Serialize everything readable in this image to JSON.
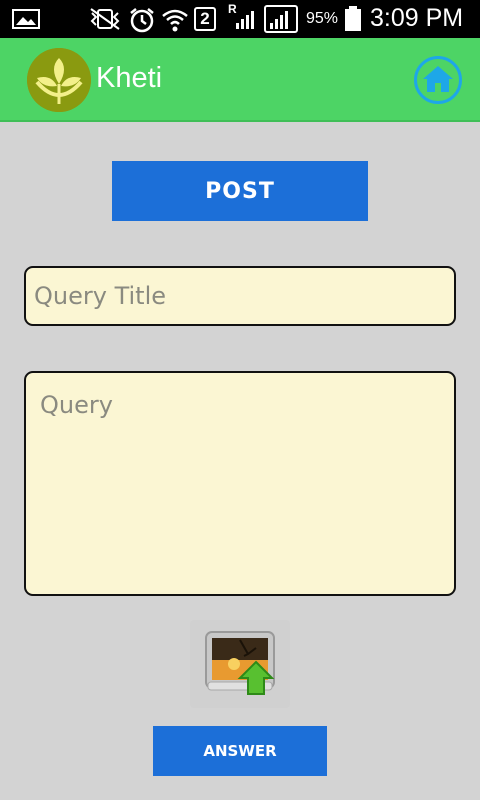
{
  "status_bar": {
    "signal_badge": "2",
    "roaming": "R",
    "battery": "95%",
    "time": "3:09 PM"
  },
  "app": {
    "title": "Kheti",
    "brand_color": "#4dd465",
    "logo_icon": "leaf-logo-icon",
    "home_icon": "home-icon"
  },
  "form": {
    "post_label": "POST",
    "title_placeholder": "Query Title",
    "query_placeholder": "Query",
    "image_upload_icon": "image-upload-icon",
    "answer_label": "ANSWER"
  },
  "colors": {
    "button": "#1c6fd8",
    "field_bg": "#fbf6d3",
    "page_bg": "#d3d3d3"
  }
}
